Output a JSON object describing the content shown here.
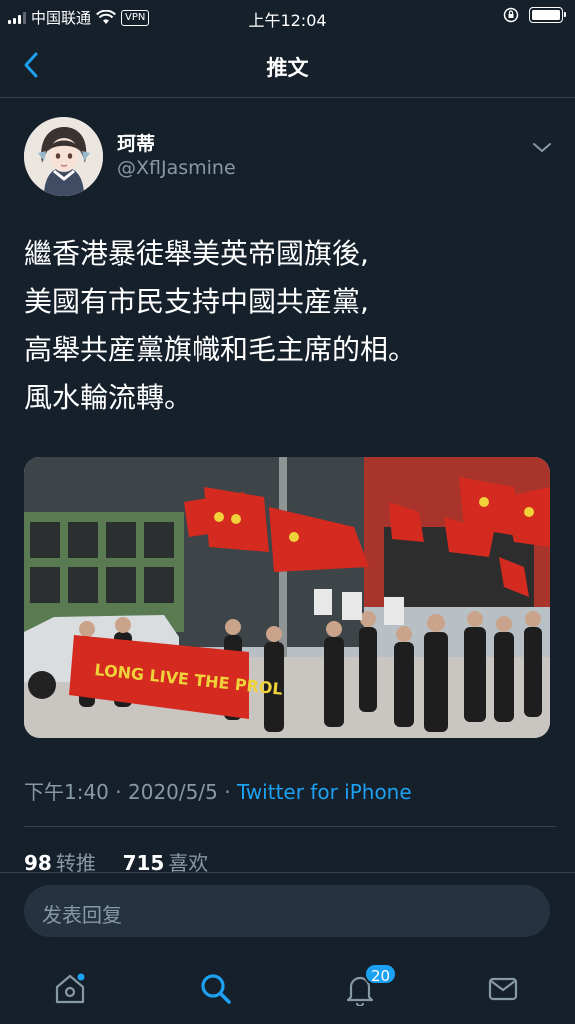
{
  "status_bar": {
    "carrier": "中国联通",
    "vpn": "VPN",
    "time": "上午12:04"
  },
  "nav": {
    "title": "推文"
  },
  "tweet": {
    "display_name": "珂蒂",
    "handle": "@XflJasmine",
    "text_lines": [
      "繼香港暴徒舉美英帝國旗後,",
      "美國有市民支持中國共産黨,",
      "高舉共産黨旗幟和毛主席的相。",
      "風水輪流轉。"
    ],
    "banner_text": "LONG LIVE THE PROL",
    "time": "下午1:40",
    "date": "2020/5/5",
    "separator": "·",
    "source": "Twitter for iPhone",
    "retweet_count": "98",
    "retweet_label": "转推",
    "like_count": "715",
    "like_label": "喜欢"
  },
  "reply": {
    "placeholder": "发表回复"
  },
  "tabs": {
    "notifications_badge": "20"
  },
  "colors": {
    "background": "#15202b",
    "accent": "#1da1f2",
    "secondary_text": "#8899a6",
    "divider": "#38444d"
  }
}
